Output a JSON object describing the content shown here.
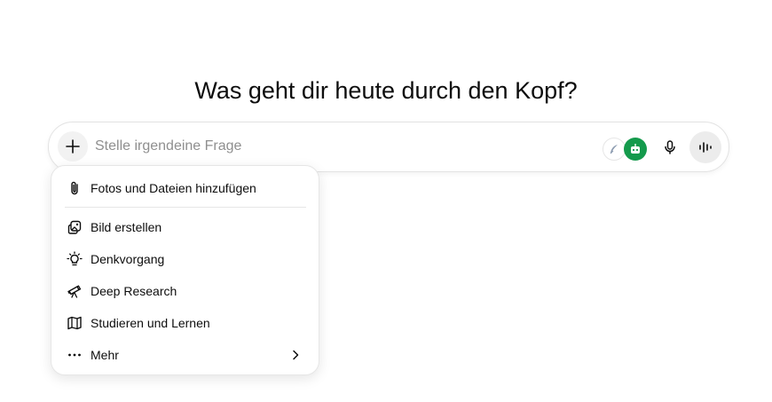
{
  "heading": "Was geht dir heute durch den Kopf?",
  "composer": {
    "placeholder": "Stelle irgendeine Frage",
    "value": "",
    "plus_icon": "plus-icon",
    "extensions": [
      {
        "icon": "feather-icon",
        "color": "#8b9bb0"
      },
      {
        "icon": "robot-icon",
        "color": "#149a4c"
      }
    ],
    "mic_icon": "microphone-icon",
    "voice_icon": "voice-waveform-icon"
  },
  "menu": {
    "items": [
      {
        "label": "Fotos und Dateien hinzufügen",
        "icon": "paperclip-icon"
      },
      {
        "label": "Bild erstellen",
        "icon": "image-icon"
      },
      {
        "label": "Denkvorgang",
        "icon": "lightbulb-icon"
      },
      {
        "label": "Deep Research",
        "icon": "telescope-icon"
      },
      {
        "label": "Studieren und Lernen",
        "icon": "book-icon"
      },
      {
        "label": "Mehr",
        "icon": "ellipsis-icon",
        "submenu_icon": "chevron-right-icon"
      }
    ]
  }
}
